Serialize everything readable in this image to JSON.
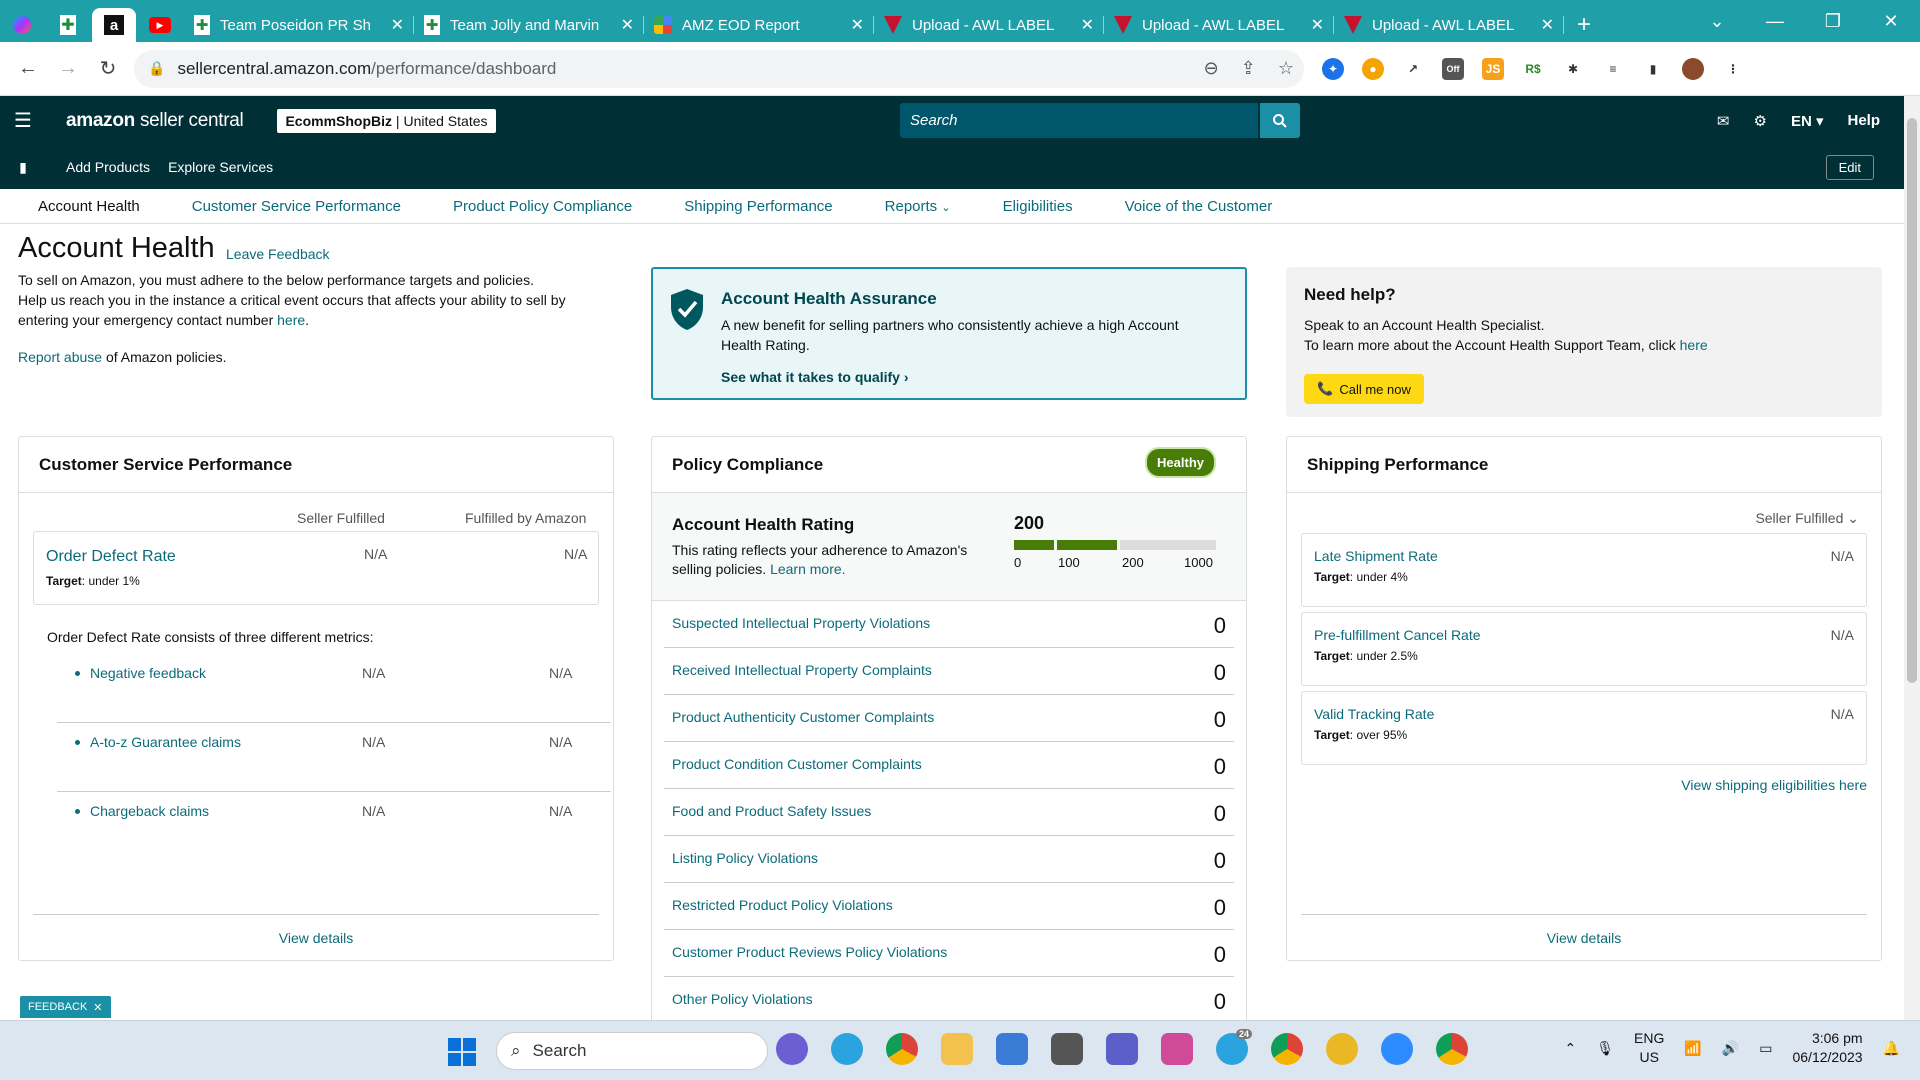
{
  "browser": {
    "tabs": [
      {
        "title": "Team Poseidon PR Sh",
        "icon": "sheets-icon"
      },
      {
        "title": "Team Jolly and Marvin",
        "icon": "sheets-icon"
      },
      {
        "title": "AMZ EOD Report",
        "icon": "multicolor-icon"
      },
      {
        "title": "Upload - AWL LABEL",
        "icon": "awl-icon"
      },
      {
        "title": "Upload - AWL LABEL",
        "icon": "awl-icon"
      },
      {
        "title": "Upload - AWL LABEL",
        "icon": "awl-icon"
      }
    ],
    "url_domain": "sellercentral.amazon.com",
    "url_path": "/performance/dashboard"
  },
  "header": {
    "logo_brand": "amazon",
    "logo_text": "seller central",
    "store_name": "EcommShopBiz",
    "store_region": "United States",
    "search_placeholder": "Search",
    "lang": "EN",
    "help": "Help",
    "links": [
      "Add Products",
      "Explore Services"
    ],
    "edit": "Edit"
  },
  "subnav": {
    "items": [
      "Account Health",
      "Customer Service Performance",
      "Product Policy Compliance",
      "Shipping Performance",
      "Reports",
      "Eligibilities",
      "Voice of the Customer"
    ]
  },
  "page": {
    "title": "Account Health",
    "leave_feedback": "Leave Feedback",
    "intro_1": "To sell on Amazon, you must adhere to the below performance targets and policies.",
    "intro_2": "Help us reach you in the instance a critical event occurs that affects your ability to sell by entering your emergency contact number",
    "intro_link": "here",
    "report_link": "Report abuse",
    "report_rest": "of Amazon policies."
  },
  "assurance": {
    "title": "Account Health Assurance",
    "desc": "A new benefit for selling partners who consistently achieve a high Account Health Rating.",
    "qualify": "See what it takes to qualify"
  },
  "help": {
    "title": "Need help?",
    "line1": "Speak to an Account Health Specialist.",
    "line2": "To learn more about the Account Health Support Team, click",
    "line2_link": "here",
    "call": "Call me now"
  },
  "csp": {
    "title": "Customer Service Performance",
    "col1": "Seller Fulfilled",
    "col2": "Fulfilled by Amazon",
    "odr_name": "Order Defect Rate",
    "odr_target_label": "Target",
    "odr_target": ": under 1%",
    "odr_v1": "N/A",
    "odr_v2": "N/A",
    "consists": "Order Defect Rate consists of three different metrics:",
    "metrics": [
      {
        "name": "Negative feedback",
        "v1": "N/A",
        "v2": "N/A"
      },
      {
        "name": "A-to-z Guarantee claims",
        "v1": "N/A",
        "v2": "N/A"
      },
      {
        "name": "Chargeback claims",
        "v1": "N/A",
        "v2": "N/A"
      }
    ],
    "view": "View details"
  },
  "pc": {
    "title": "Policy Compliance",
    "badge": "Healthy",
    "ahr_title": "Account Health Rating",
    "ahr_desc": "This rating reflects your adherence to Amazon's selling policies.",
    "ahr_link": "Learn more.",
    "ahr_value": "200",
    "ahr_ticks": [
      "0",
      "100",
      "200",
      "1000"
    ],
    "colors": {
      "good": "#487d07",
      "empty": "#dddddd"
    },
    "rows": [
      {
        "name": "Suspected Intellectual Property Violations",
        "value": "0"
      },
      {
        "name": "Received Intellectual Property Complaints",
        "value": "0"
      },
      {
        "name": "Product Authenticity Customer Complaints",
        "value": "0"
      },
      {
        "name": "Product Condition Customer Complaints",
        "value": "0"
      },
      {
        "name": "Food and Product Safety Issues",
        "value": "0"
      },
      {
        "name": "Listing Policy Violations",
        "value": "0"
      },
      {
        "name": "Restricted Product Policy Violations",
        "value": "0"
      },
      {
        "name": "Customer Product Reviews Policy Violations",
        "value": "0"
      },
      {
        "name": "Other Policy Violations",
        "value": "0"
      }
    ]
  },
  "sp": {
    "title": "Shipping Performance",
    "select": "Seller Fulfilled",
    "rows": [
      {
        "name": "Late Shipment Rate",
        "target": ": under 4%",
        "value": "N/A"
      },
      {
        "name": "Pre-fulfillment Cancel Rate",
        "target": ": under 2.5%",
        "value": "N/A"
      },
      {
        "name": "Valid Tracking Rate",
        "target": ": over 95%",
        "value": "N/A"
      }
    ],
    "target_label": "Target",
    "eligibilities": "View shipping eligibilities here",
    "view": "View details"
  },
  "feedback": "FEEDBACK",
  "taskbar": {
    "search": "Search",
    "lang1": "ENG",
    "lang2": "US",
    "time": "3:06 pm",
    "date": "06/12/2023",
    "badge": "24"
  }
}
